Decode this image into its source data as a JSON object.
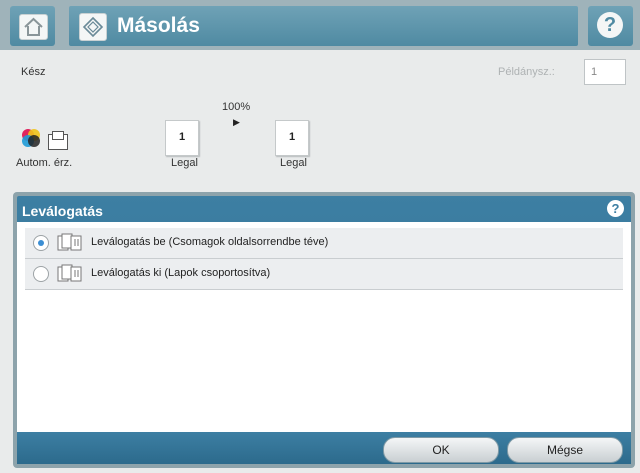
{
  "header": {
    "title": "Másolás",
    "home_icon": "home-icon",
    "copy_icon": "copy-icon",
    "help_icon": "help-icon",
    "help_glyph": "?"
  },
  "status": {
    "text": "Kész",
    "copies_label": "Példánysz.:",
    "copies_value": "1"
  },
  "preview": {
    "zoom": "100%",
    "original_page_number": "1",
    "original_size": "Legal",
    "output_page_number": "1",
    "output_size": "Legal",
    "color_mode_label": "Autom. érz."
  },
  "dialog": {
    "title": "Leválogatás",
    "help_glyph": "?",
    "options": [
      {
        "label": "Leválogatás be (Csomagok oldalsorrendbe téve)",
        "selected": true
      },
      {
        "label": "Leválogatás ki (Lapok csoportosítva)",
        "selected": false
      }
    ],
    "ok_label": "OK",
    "cancel_label": "Mégse"
  },
  "colors": {
    "accent": "#3d7fa3",
    "header_bg": "#9fb3ba",
    "radio_selected": "#3b8ed3"
  }
}
